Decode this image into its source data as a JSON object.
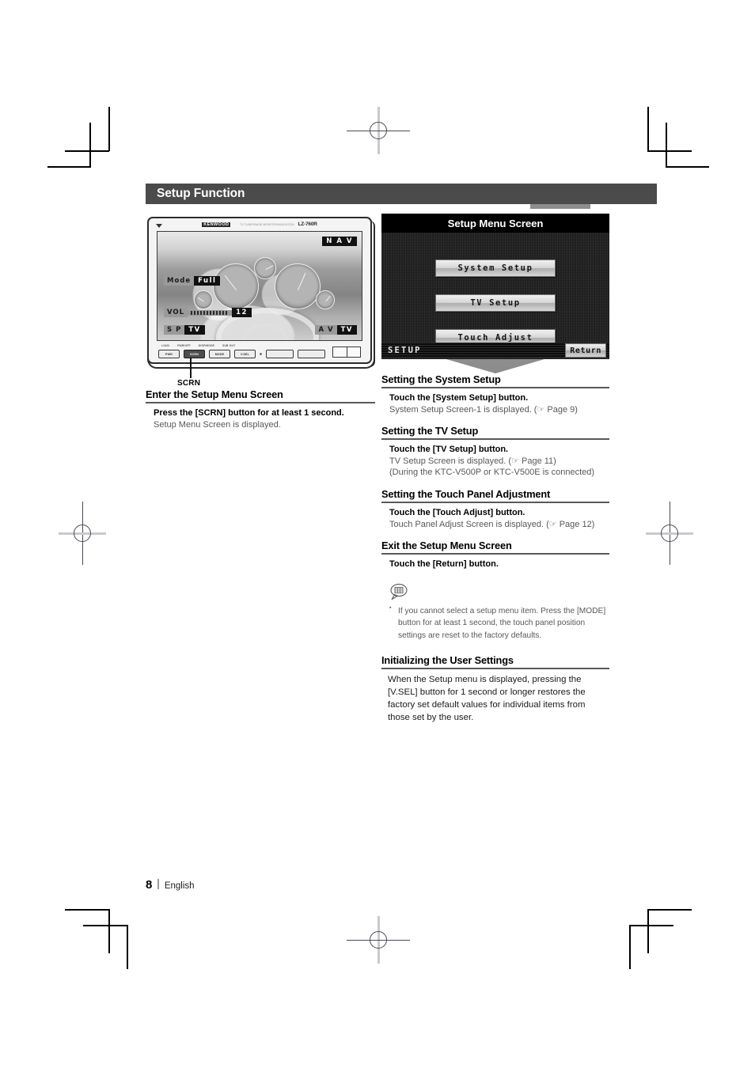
{
  "chapter": {
    "title": "Setup Function"
  },
  "left": {
    "device": {
      "brand": "KENWOOD",
      "descriptor": "TV TUNER/WIDE MONITOR/NAVIGATION",
      "model": "LZ-760R",
      "osd": {
        "nav": "N A V",
        "mode_label": "Mode",
        "mode_value": "Full",
        "vol_label": "VOL",
        "vol_value": "12",
        "sp_label": "S P",
        "sp_value": "TV",
        "av_label": "A V",
        "av_value": "TV"
      },
      "panel_captions": [
        "LOUD",
        "PWR/OFF",
        "DISP/MODE",
        "SUB OUT"
      ],
      "buttons": [
        "PWR",
        "SCRN",
        "MODE",
        "V.SEL"
      ]
    },
    "callout_label": "SCRN",
    "section": {
      "heading": "Enter the Setup Menu Screen",
      "step_bold": "Press the [SCRN] button for at least 1 second.",
      "step_body": "Setup Menu Screen is displayed."
    }
  },
  "right": {
    "screen_title": "Setup Menu Screen",
    "menu": {
      "buttons": [
        "System Setup",
        "TV Setup",
        "Touch Adjust"
      ],
      "status_label": "SETUP",
      "return_label": "Return"
    },
    "sections": [
      {
        "heading": "Setting the System Setup",
        "step_bold": "Touch the [System Setup] button.",
        "step_body": "System Setup Screen-1 is displayed. (☞ Page 9)"
      },
      {
        "heading": "Setting the TV Setup",
        "step_bold": "Touch the [TV Setup] button.",
        "step_body": "TV Setup Screen is displayed. (☞ Page 11)",
        "step_body2": "(During the KTC-V500P or KTC-V500E is connected)"
      },
      {
        "heading": "Setting the Touch Panel Adjustment",
        "step_bold": "Touch the [Touch Adjust] button.",
        "step_body": "Touch Panel Adjust Screen is displayed. (☞ Page 12)"
      },
      {
        "heading": "Exit the Setup Menu Screen",
        "step_bold": "Touch the [Return] button."
      }
    ],
    "note": {
      "items": [
        "If you cannot select a setup menu item. Press the [MODE] button for at least 1 second, the touch panel position settings are reset to the factory defaults."
      ]
    },
    "final_section": {
      "heading": "Initializing the User Settings",
      "body": "When the Setup menu is displayed,  pressing the [V.SEL] button for 1 second or longer restores the factory set default values for individual items from those set by the user."
    }
  },
  "footer": {
    "page_number": "8",
    "language": "English"
  }
}
